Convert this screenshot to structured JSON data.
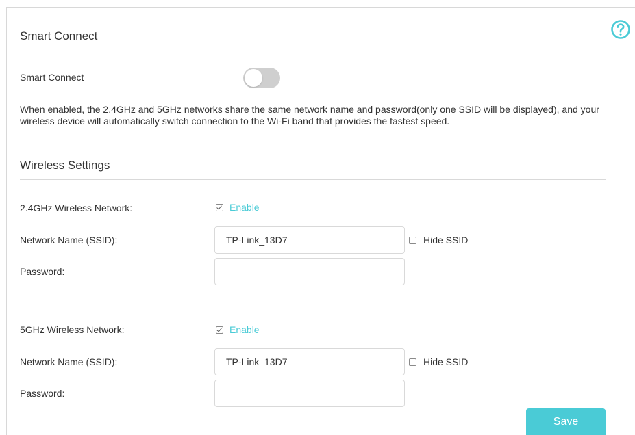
{
  "help": {
    "icon": "question-circle-icon",
    "color": "#4acbd6"
  },
  "smart_connect": {
    "section_title": "Smart Connect",
    "label": "Smart Connect",
    "enabled": false,
    "description": "When enabled, the 2.4GHz and 5GHz networks share the same network name and password(only one SSID will be displayed), and your wireless device will automatically switch connection to the Wi-Fi band that provides the fastest speed."
  },
  "wireless": {
    "section_title": "Wireless Settings",
    "band_24": {
      "network_label": "2.4GHz Wireless Network:",
      "enable_label": "Enable",
      "enabled": true,
      "ssid_label": "Network Name (SSID):",
      "ssid_value": "TP-Link_13D7",
      "hide_ssid_label": "Hide SSID",
      "hide_ssid": false,
      "password_label": "Password:",
      "password_value": ""
    },
    "band_5": {
      "network_label": "5GHz Wireless Network:",
      "enable_label": "Enable",
      "enabled": true,
      "ssid_label": "Network Name (SSID):",
      "ssid_value": "TP-Link_13D7",
      "hide_ssid_label": "Hide SSID",
      "hide_ssid": false,
      "password_label": "Password:",
      "password_value": ""
    }
  },
  "actions": {
    "save_label": "Save"
  },
  "colors": {
    "accent": "#4acbd6",
    "toggle_off": "#cfcfcf",
    "divider": "#d9d9d9"
  }
}
